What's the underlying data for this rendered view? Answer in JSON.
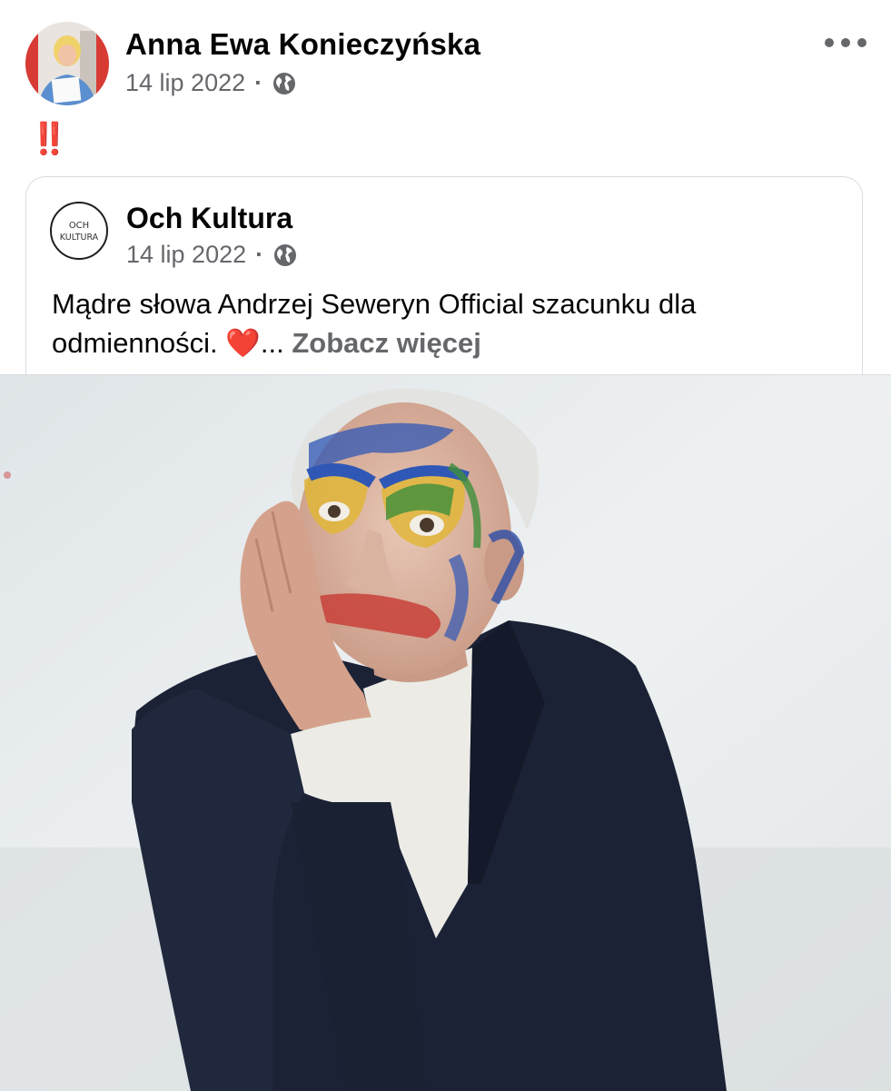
{
  "post": {
    "author": "Anna Ewa Konieczyńska",
    "date": "14 lip 2022",
    "separator": "·",
    "audience_icon": "globe-icon",
    "more_icon": "more-options-icon",
    "text": "‼️"
  },
  "shared": {
    "author": "Och Kultura",
    "avatar_text_top": "OCH",
    "avatar_text_bottom": "KULTURA",
    "date": "14 lip 2022",
    "separator": "·",
    "audience_icon": "globe-icon",
    "text_main": "Mądre słowa Andrzej Seweryn Official  szacunku dla odmienności. ",
    "heart": "❤️",
    "ellipsis": "... ",
    "see_more": "Zobacz więcej"
  },
  "colors": {
    "author_text": "#050505",
    "meta_text": "#65676b",
    "exclamation": "#e0352b",
    "card_border": "#dadde1",
    "jacket": "#1b2235"
  }
}
